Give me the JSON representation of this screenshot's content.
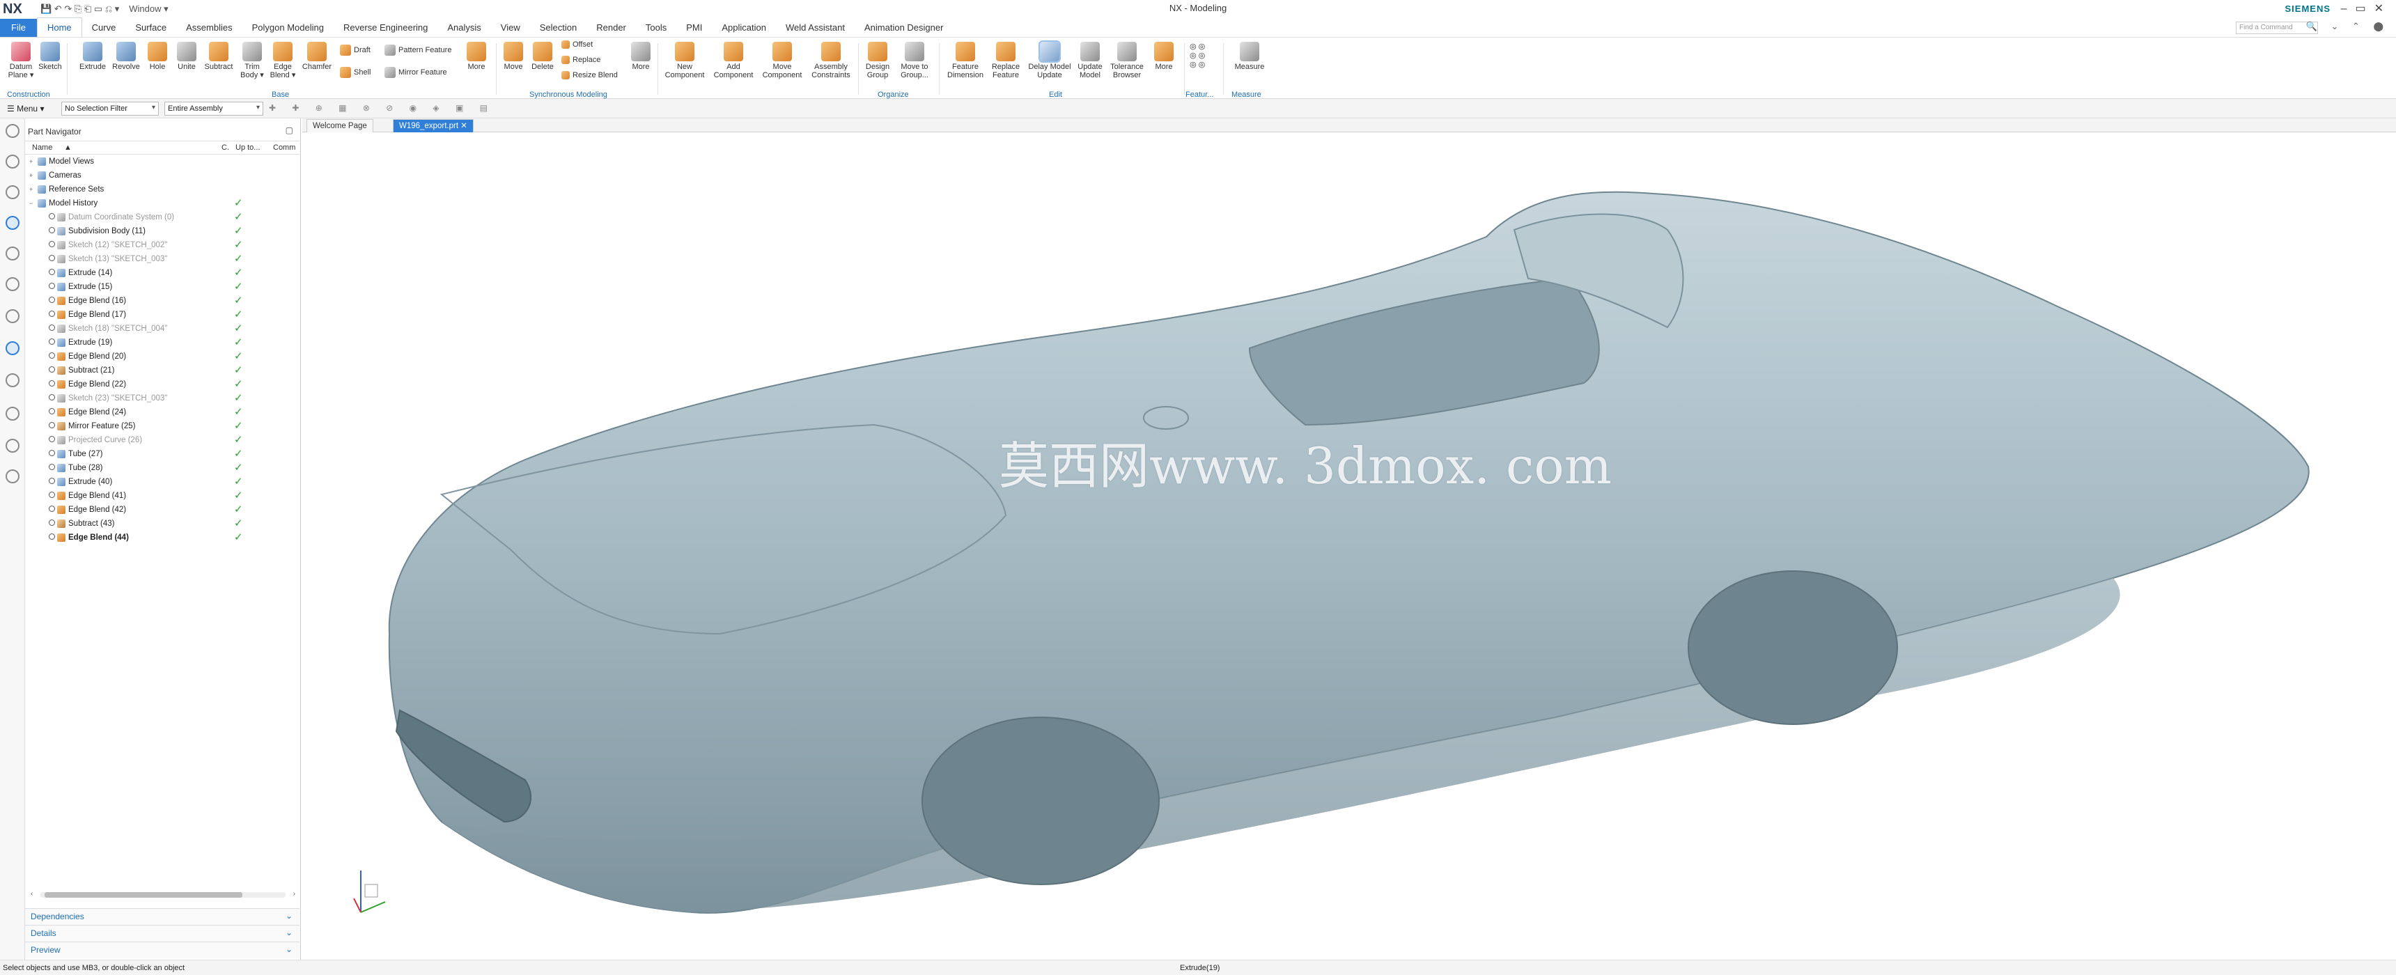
{
  "app": {
    "logo": "NX",
    "title": "NX - Modeling",
    "brand": "SIEMENS",
    "window_menu": "Window ▾"
  },
  "tabs": [
    "File",
    "Home",
    "Curve",
    "Surface",
    "Assemblies",
    "Polygon Modeling",
    "Reverse Engineering",
    "Analysis",
    "View",
    "Selection",
    "Render",
    "Tools",
    "PMI",
    "Application",
    "Weld Assistant",
    "Animation Designer"
  ],
  "search": {
    "placeholder": "Find a Command"
  },
  "ribbon": {
    "datum_plane": "Datum Plane ▾",
    "sketch": "Sketch",
    "extrude": "Extrude",
    "revolve": "Revolve",
    "hole": "Hole",
    "unite": "Unite",
    "subtract": "Subtract",
    "trim_body": "Trim Body ▾",
    "edge_blend": "Edge Blend ▾",
    "chamfer": "Chamfer",
    "draft": "Draft",
    "shell": "Shell",
    "pattern_feature": "Pattern Feature",
    "mirror_feature": "Mirror Feature",
    "more1": "More",
    "move": "Move",
    "delete": "Delete",
    "offset": "Offset",
    "replace": "Replace",
    "resize_blend": "Resize Blend",
    "more2": "More",
    "new_component": "New Component",
    "add_component": "Add Component",
    "move_component": "Move Component",
    "assembly_constraints": "Assembly Constraints",
    "design_group": "Design Group",
    "move_to_group": "Move to Group...",
    "feature_dimension": "Feature Dimension",
    "replace_feature": "Replace Feature",
    "delay_model_update": "Delay Model Update",
    "update_model": "Update Model",
    "tolerance_browser": "Tolerance Browser",
    "more3": "More",
    "measure": "Measure",
    "groups": {
      "construction": "Construction",
      "base": "Base",
      "synchronous": "Synchronous Modeling",
      "organize": "Organize",
      "edit": "Edit",
      "feature": "Featur...",
      "measure": "Measure"
    }
  },
  "selection_bar": {
    "menu": "☰ Menu ▾",
    "filter": "No Selection Filter",
    "scope": "Entire Assembly"
  },
  "navigator": {
    "title": "Part Navigator",
    "columns": {
      "name": "Name",
      "c": "C.",
      "uptodate": "Up to...",
      "comment": "Comm"
    },
    "items": [
      {
        "label": "Model Views",
        "level": 0,
        "type": "folder",
        "check": false
      },
      {
        "label": "Cameras",
        "level": 0,
        "type": "folder",
        "check": false
      },
      {
        "label": "Reference Sets",
        "level": 0,
        "type": "folder",
        "check": false
      },
      {
        "label": "Model History",
        "level": 0,
        "type": "folder",
        "check": true
      },
      {
        "label": "Datum Coordinate System (0)",
        "level": 1,
        "type": "datum",
        "check": true,
        "dim": true
      },
      {
        "label": "Subdivision Body (11)",
        "level": 1,
        "type": "body",
        "check": true
      },
      {
        "label": "Sketch (12) \"SKETCH_002\"",
        "level": 1,
        "type": "sketch",
        "check": true,
        "dim": true
      },
      {
        "label": "Sketch (13) \"SKETCH_003\"",
        "level": 1,
        "type": "sketch",
        "check": true,
        "dim": true
      },
      {
        "label": "Extrude (14)",
        "level": 1,
        "type": "extrude",
        "check": true
      },
      {
        "label": "Extrude (15)",
        "level": 1,
        "type": "extrude",
        "check": true
      },
      {
        "label": "Edge Blend (16)",
        "level": 1,
        "type": "blend",
        "check": true
      },
      {
        "label": "Edge Blend (17)",
        "level": 1,
        "type": "blend",
        "check": true
      },
      {
        "label": "Sketch (18) \"SKETCH_004\"",
        "level": 1,
        "type": "sketch",
        "check": true,
        "dim": true
      },
      {
        "label": "Extrude (19)",
        "level": 1,
        "type": "extrude",
        "check": true
      },
      {
        "label": "Edge Blend (20)",
        "level": 1,
        "type": "blend",
        "check": true
      },
      {
        "label": "Subtract (21)",
        "level": 1,
        "type": "subtract",
        "check": true
      },
      {
        "label": "Edge Blend (22)",
        "level": 1,
        "type": "blend",
        "check": true
      },
      {
        "label": "Sketch (23) \"SKETCH_003\"",
        "level": 1,
        "type": "sketch",
        "check": true,
        "dim": true
      },
      {
        "label": "Edge Blend (24)",
        "level": 1,
        "type": "blend",
        "check": true
      },
      {
        "label": "Mirror Feature (25)",
        "level": 1,
        "type": "mirror",
        "check": true
      },
      {
        "label": "Projected Curve (26)",
        "level": 1,
        "type": "sketch",
        "check": true,
        "dim": true
      },
      {
        "label": "Tube (27)",
        "level": 1,
        "type": "extrude",
        "check": true
      },
      {
        "label": "Tube (28)",
        "level": 1,
        "type": "extrude",
        "check": true
      },
      {
        "label": "Extrude (40)",
        "level": 1,
        "type": "extrude",
        "check": true
      },
      {
        "label": "Edge Blend (41)",
        "level": 1,
        "type": "blend",
        "check": true
      },
      {
        "label": "Edge Blend (42)",
        "level": 1,
        "type": "blend",
        "check": true
      },
      {
        "label": "Subtract (43)",
        "level": 1,
        "type": "subtract",
        "check": true
      },
      {
        "label": "Edge Blend (44)",
        "level": 1,
        "type": "blend",
        "check": true,
        "bold": true
      }
    ],
    "sections": [
      "Dependencies",
      "Details",
      "Preview"
    ]
  },
  "doc_tabs": {
    "welcome": "Welcome Page",
    "model": "W196_export.prt ✕"
  },
  "watermark": "莫西网www. 3dmox. com",
  "status": {
    "left": "Select objects and use MB3, or double-click an object",
    "middle": "Extrude(19)"
  },
  "colors": {
    "accent": "#2f7ed8",
    "check": "#2e9e2e",
    "model": "#a9bdc6"
  }
}
